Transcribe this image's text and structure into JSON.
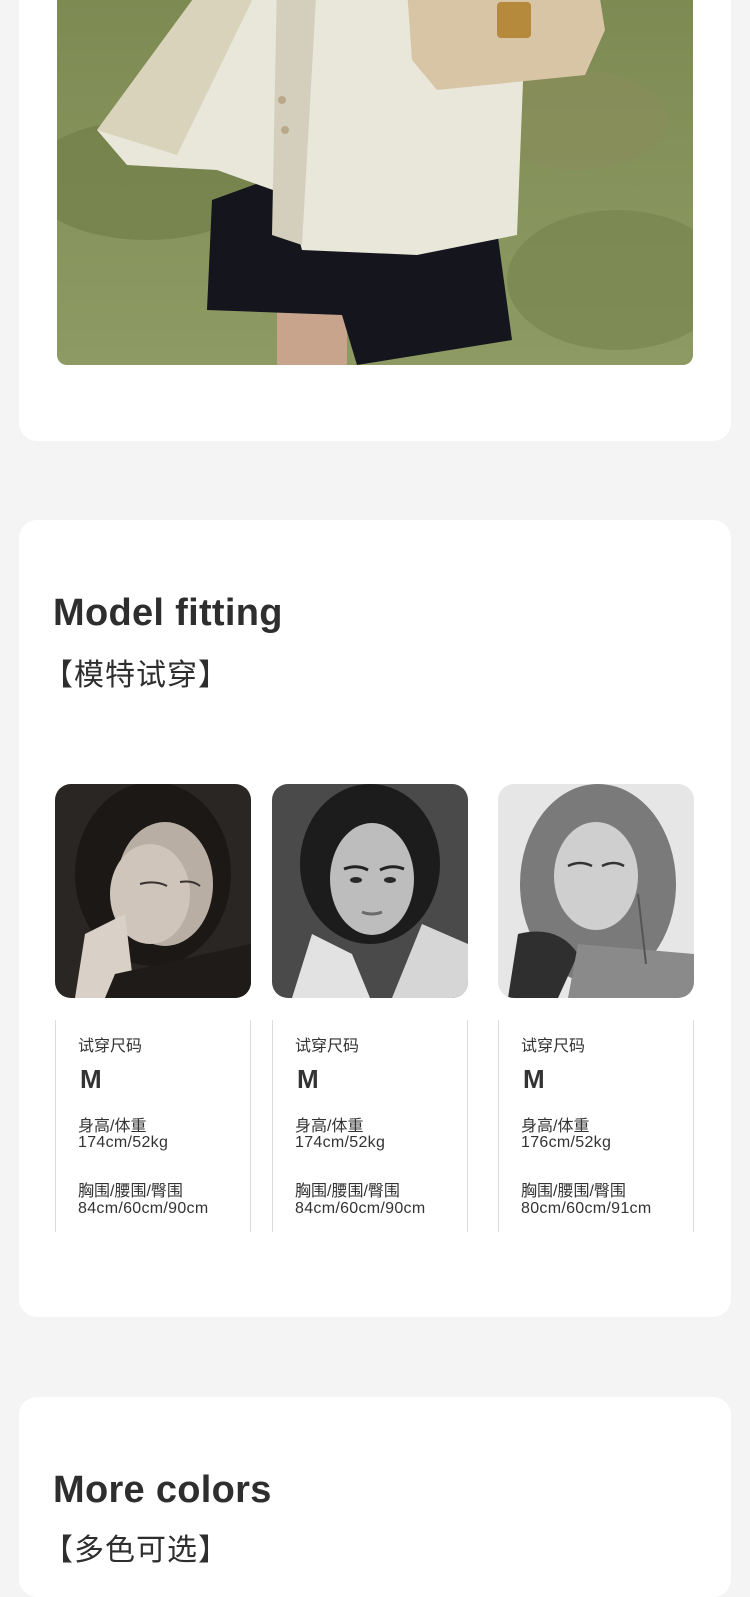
{
  "sections": {
    "fitting": {
      "title": "Model fitting",
      "subtitle": "【模特试穿】"
    },
    "colors": {
      "title": "More colors",
      "subtitle": "【多色可选】"
    }
  },
  "models": [
    {
      "size_label": "试穿尺码",
      "size": "M",
      "hw_label": "身高/体重",
      "hw": "174cm/52kg",
      "bwh_label": "胸围/腰围/臀围",
      "bwh": "84cm/60cm/90cm"
    },
    {
      "size_label": "试穿尺码",
      "size": "M",
      "hw_label": "身高/体重",
      "hw": "174cm/52kg",
      "bwh_label": "胸围/腰围/臀围",
      "bwh": "84cm/60cm/90cm"
    },
    {
      "size_label": "试穿尺码",
      "size": "M",
      "hw_label": "身高/体重",
      "hw": "176cm/52kg",
      "bwh_label": "胸围/腰围/臀围",
      "bwh": "80cm/60cm/91cm"
    }
  ],
  "colors": {
    "page_bg": "#f4f4f4",
    "card_bg": "#ffffff",
    "title_text": "#2e2e2e",
    "divider": "#dcdcdc"
  }
}
